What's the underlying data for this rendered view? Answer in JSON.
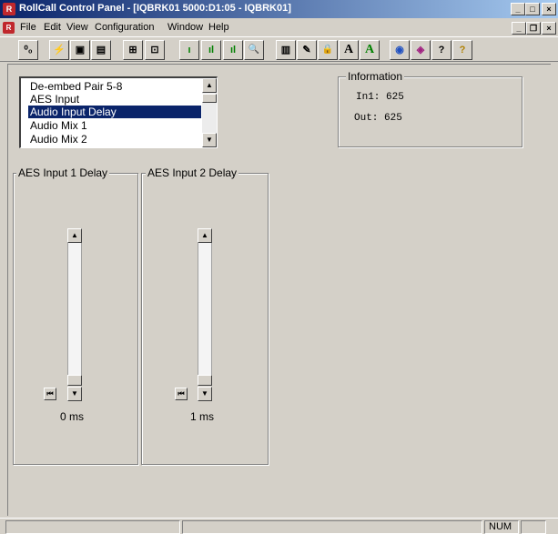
{
  "window": {
    "title": "RollCall Control Panel - [IQBRK01 5000:D1:05 - IQBRK01]",
    "app_icon": "rollcall-logo-icon",
    "buttons": {
      "minimize": "_",
      "restore": "□",
      "close": "×"
    }
  },
  "menubar": {
    "items": [
      "File",
      "Edit",
      "View",
      "Configuration",
      "Window",
      "Help"
    ],
    "doc_buttons": {
      "minimize": "_",
      "restore": "❐",
      "close": "×"
    }
  },
  "toolbar": {
    "buttons": [
      {
        "icon": "connect-icon",
        "glyph": "⁰₀"
      },
      {
        "icon": "flash-icon",
        "glyph": "⚡"
      },
      {
        "icon": "save-icon",
        "glyph": "▣"
      },
      {
        "icon": "save-all-icon",
        "glyph": "▤"
      },
      {
        "icon": "network-icon",
        "glyph": "⊞"
      },
      {
        "icon": "network-node-icon",
        "glyph": "⊡"
      },
      {
        "icon": "level-low-icon",
        "glyph": "ı"
      },
      {
        "icon": "level-mid-icon",
        "glyph": "ıl"
      },
      {
        "icon": "level-high-icon",
        "glyph": "ıl"
      },
      {
        "icon": "search-icon",
        "glyph": "🔍"
      },
      {
        "icon": "book-icon",
        "glyph": "▥"
      },
      {
        "icon": "edit-icon",
        "glyph": "✎"
      },
      {
        "icon": "lock-icon",
        "glyph": "🔒"
      },
      {
        "icon": "font-a-icon",
        "glyph": "A"
      },
      {
        "icon": "font-a-green-icon",
        "glyph": "A"
      },
      {
        "icon": "globe-icon",
        "glyph": "◉"
      },
      {
        "icon": "eraser-icon",
        "glyph": "◈"
      },
      {
        "icon": "help-context-icon",
        "glyph": "?"
      },
      {
        "icon": "help-icon",
        "glyph": "?"
      }
    ]
  },
  "listbox": {
    "items": [
      "De-embed Pair 5-8",
      "AES Input",
      "Audio Input Delay",
      "Audio Mix 1",
      "Audio Mix 2"
    ],
    "selected_index": 2
  },
  "information": {
    "title": "Information",
    "in1": "In1: 625",
    "out": "Out: 625"
  },
  "sliders": [
    {
      "title": "AES Input 1 Delay",
      "value": "0 ms",
      "level_fraction": 0.0
    },
    {
      "title": "AES Input 2 Delay",
      "value": "1 ms",
      "level_fraction": 0.0
    }
  ],
  "statusbar": {
    "num": "NUM"
  }
}
